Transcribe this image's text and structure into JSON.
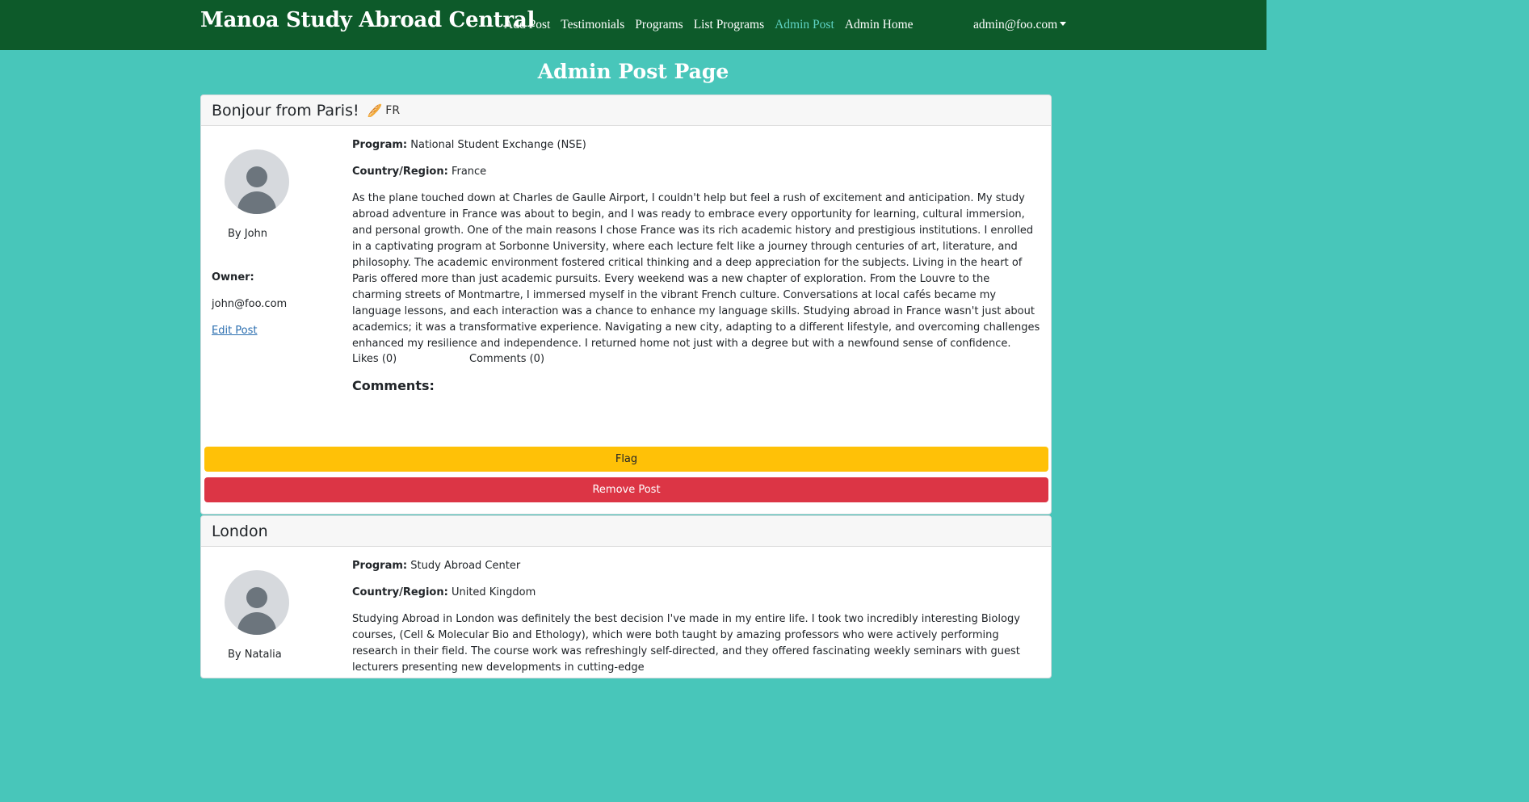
{
  "navbar": {
    "brand": "Manoa Study Abroad Central",
    "links": [
      "Add Post",
      "Testimonials",
      "Programs",
      "List Programs",
      "Admin Post",
      "Admin Home"
    ],
    "active_link": "Admin Post",
    "user": "admin@foo.com"
  },
  "page": {
    "title": "Admin Post Page"
  },
  "colors": {
    "navbar_bg": "#0d5a2a",
    "page_bg": "#48c6ba",
    "active_link": "#5fd3c4",
    "flag_button": "#ffc107",
    "remove_button": "#dc3545"
  },
  "posts": [
    {
      "title": "Bonjour from Paris!",
      "flag_icon": "baguette-icon",
      "country_code": "FR",
      "author": "By John",
      "owner_label": "Owner:",
      "owner_email": "john@foo.com",
      "edit_label": "Edit Post",
      "program_label": "Program:",
      "program": "National Student Exchange (NSE)",
      "country_label": "Country/Region:",
      "country": "France",
      "body": "As the plane touched down at Charles de Gaulle Airport, I couldn't help but feel a rush of excitement and anticipation. My study abroad adventure in France was about to begin, and I was ready to embrace every opportunity for learning, cultural immersion, and personal growth. One of the main reasons I chose France was its rich academic history and prestigious institutions. I enrolled in a captivating program at Sorbonne University, where each lecture felt like a journey through centuries of art, literature, and philosophy. The academic environment fostered critical thinking and a deep appreciation for the subjects. Living in the heart of Paris offered more than just academic pursuits. Every weekend was a new chapter of exploration. From the Louvre to the charming streets of Montmartre, I immersed myself in the vibrant French culture. Conversations at local cafés became my language lessons, and each interaction was a chance to enhance my language skills. Studying abroad in France wasn't just about academics; it was a transformative experience. Navigating a new city, adapting to a different lifestyle, and overcoming challenges enhanced my resilience and independence. I returned home not just with a degree but with a newfound sense of confidence.",
      "likes": "Likes (0)",
      "comments_count": "Comments (0)",
      "comments_heading": "Comments:",
      "flag_button": "Flag",
      "remove_button": "Remove Post"
    },
    {
      "title": "London",
      "author": "By Natalia",
      "program_label": "Program:",
      "program": "Study Abroad Center",
      "country_label": "Country/Region:",
      "country": "United Kingdom",
      "body": "Studying Abroad in London was definitely the best decision I've made in my entire life. I took two incredibly interesting Biology courses, (Cell & Molecular Bio and Ethology), which were both taught by amazing professors who were actively performing research in their field. The course work was refreshingly self-directed, and they offered fascinating weekly seminars with guest lecturers presenting new developments in cutting-edge"
    }
  ]
}
